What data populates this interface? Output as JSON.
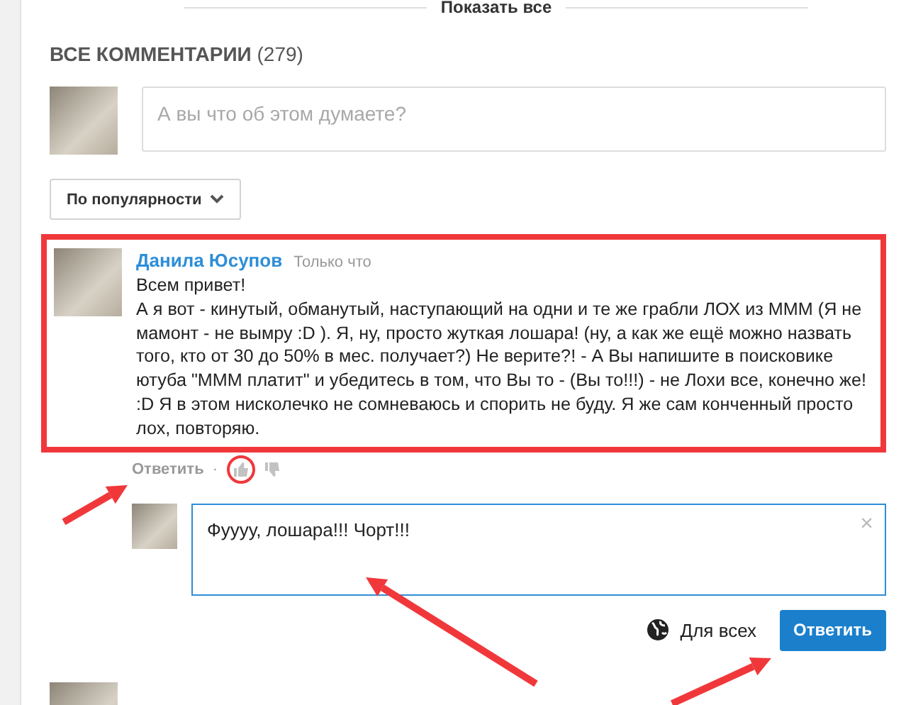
{
  "show_all": {
    "label": "Показать все"
  },
  "section": {
    "title": "ВСЕ КОММЕНТАРИИ",
    "count": "(279)"
  },
  "new_comment": {
    "placeholder": "А вы что об этом думаете?"
  },
  "sort": {
    "label": "По популярности"
  },
  "comment": {
    "author": "Данила Юсупов",
    "time": "Только что",
    "highlighted": true,
    "text": [
      "Всем привет!",
      "А я вот - кинутый, обманутый, наступающий на одни и те же грабли ЛОХ из МММ (Я не мамонт - не вымру :D ). Я, ну, просто жуткая лошара! (ну, а как же ещё можно назвать того, кто от 30 до 50% в мес. получает?)  Не верите?! - А Вы напишите в поисковике ютуба \"МММ платит\" и убедитесь в том, что Вы то - (Вы то!!!) - не Лохи все, конечно же! :D Я в этом нисколечко не сомневаюсь и спорить не буду. Я же сам конченный просто лох, повторяю."
    ],
    "reply_label": "Ответить",
    "separator": "·",
    "like_circled": true
  },
  "reply": {
    "value": "Фуууу, лошара!!! Чорт!!!",
    "close": "×",
    "audience": "Для всех",
    "submit": "Ответить"
  }
}
